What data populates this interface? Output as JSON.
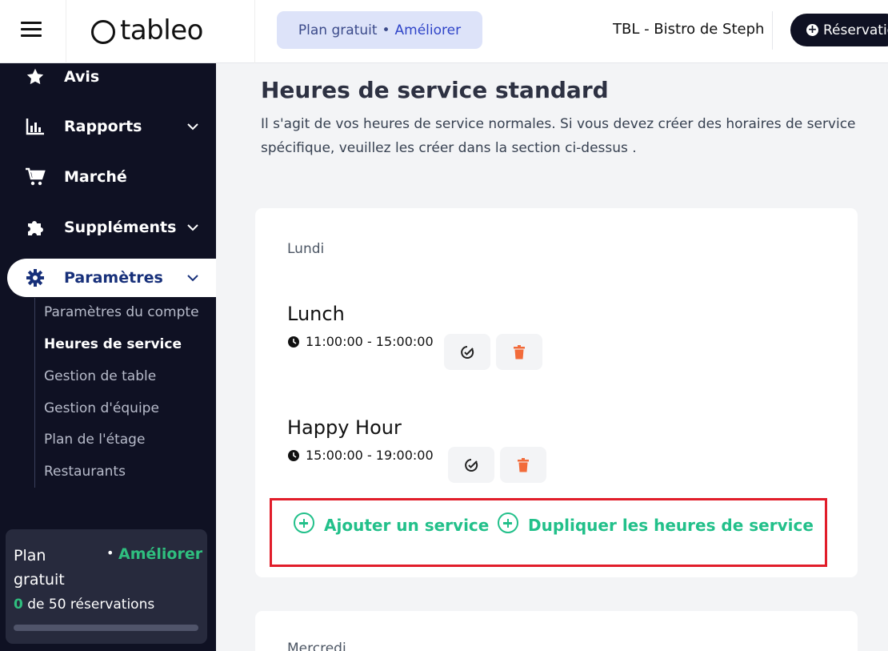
{
  "header": {
    "logo_text": "tableo",
    "plan_label": "Plan gratuit",
    "plan_separator": "•",
    "plan_upgrade": "Améliorer",
    "restaurant_name": "TBL - Bistro de Steph",
    "reservation_button": "Réservation"
  },
  "sidebar": {
    "items": [
      {
        "label": "Avis",
        "icon": "star-icon"
      },
      {
        "label": "Rapports",
        "icon": "bar-chart-icon",
        "expandable": true
      },
      {
        "label": "Marché",
        "icon": "cart-icon"
      },
      {
        "label": "Suppléments",
        "icon": "puzzle-icon",
        "expandable": true
      },
      {
        "label": "Paramètres",
        "icon": "gear-icon",
        "expandable": true,
        "active": true
      }
    ],
    "subitems": [
      {
        "label": "Paramètres du compte"
      },
      {
        "label": "Heures de service",
        "current": true
      },
      {
        "label": "Gestion de table"
      },
      {
        "label": "Gestion d'équipe"
      },
      {
        "label": "Plan de l'étage"
      },
      {
        "label": "Restaurants"
      }
    ],
    "plan_card": {
      "name": "Plan gratuit",
      "separator": "•",
      "upgrade": "Améliorer",
      "used": "0",
      "of_text": " de 50 réservations",
      "progress_fraction": 0
    }
  },
  "main": {
    "title": "Heures de service standard",
    "description": "Il s'agit de vos heures de service normales. Si vous devez créer des horaires de service spécifique, veuillez les créer dans la section ci-dessus .",
    "days": [
      {
        "day": "Lundi",
        "services": [
          {
            "name": "Lunch",
            "time": "11:00:00 - 15:00:00"
          },
          {
            "name": "Happy Hour",
            "time": "15:00:00 - 19:00:00"
          }
        ],
        "add_service": "Ajouter un service",
        "duplicate_hours": "Dupliquer les heures de service"
      },
      {
        "day": "Mercredi"
      }
    ],
    "colors": {
      "accent_green": "#22c08a",
      "delete_orange": "#f26b3a",
      "highlight_red": "#e11d2a",
      "sidebar_bg": "#0f1123"
    }
  }
}
